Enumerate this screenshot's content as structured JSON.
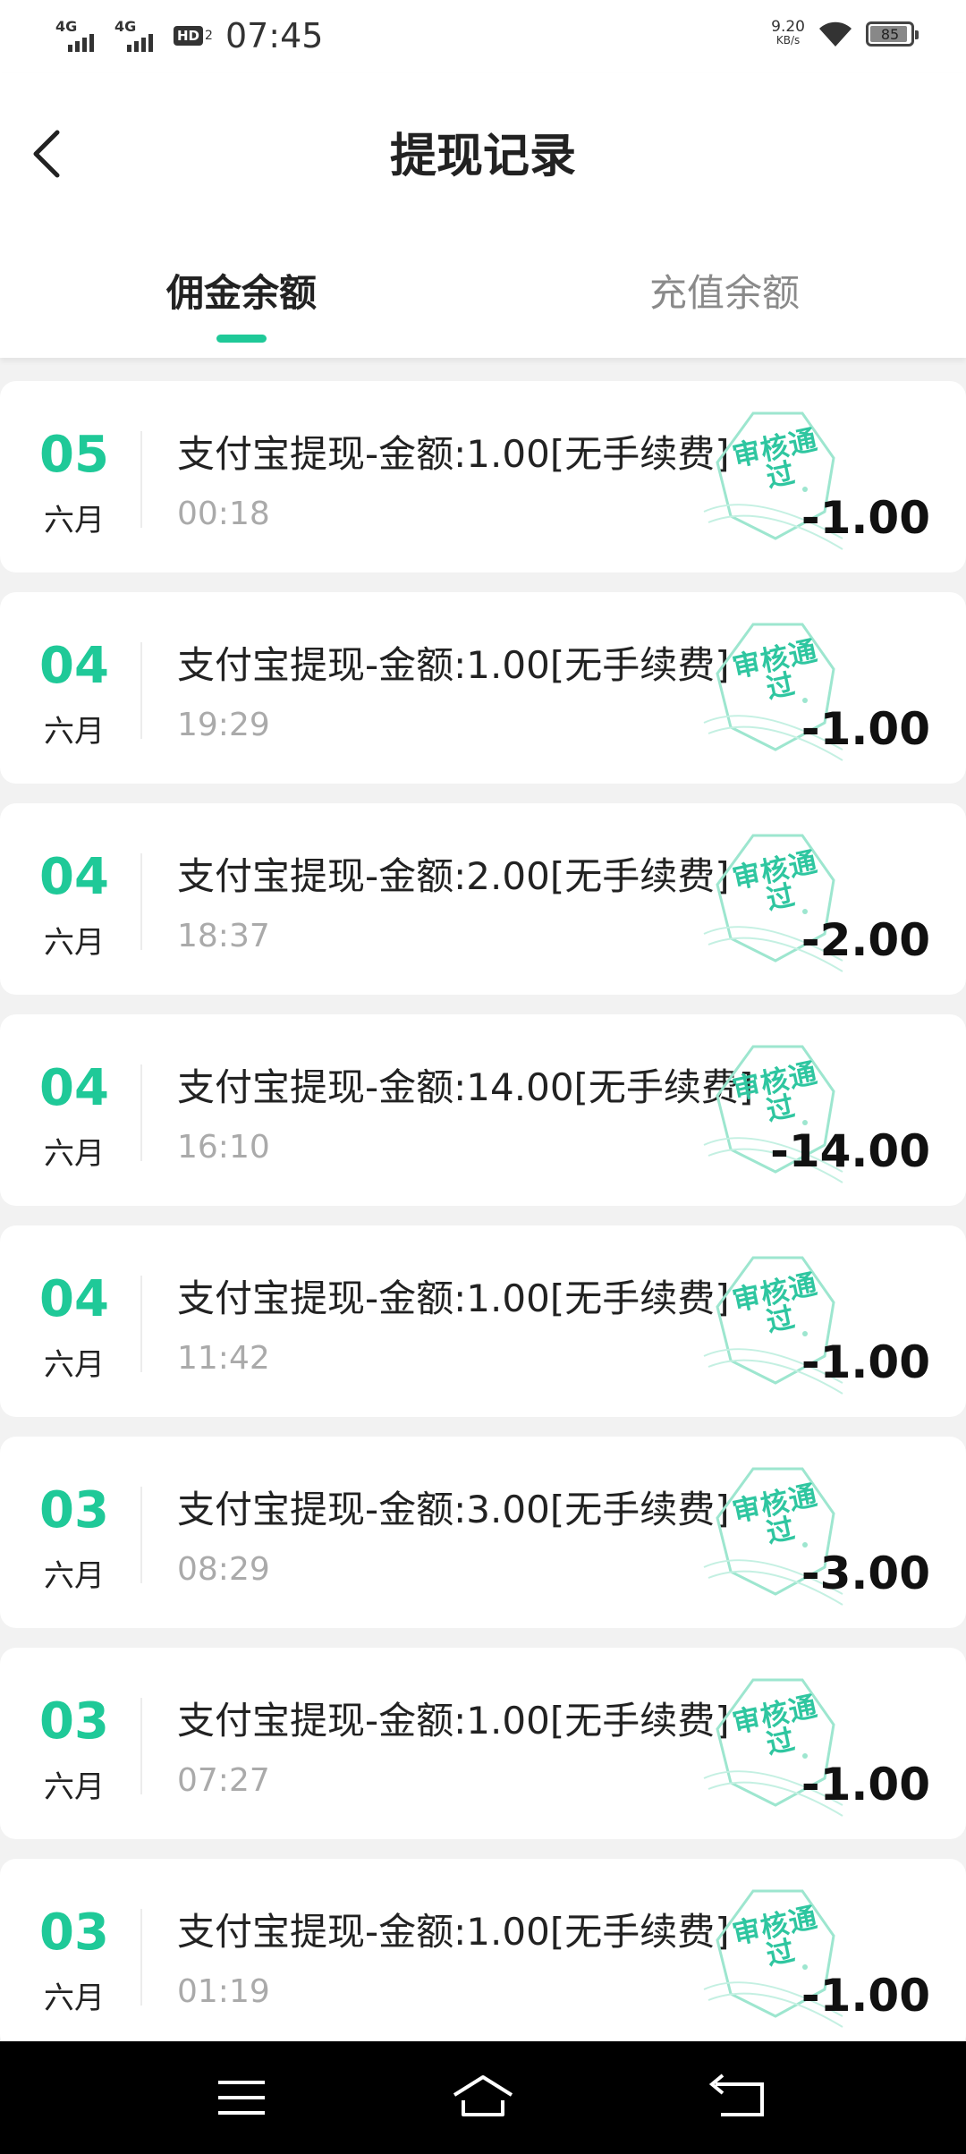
{
  "status_bar": {
    "signal1": "4G",
    "signal2": "4G",
    "hd": "HD",
    "hd_sub": "2",
    "time": "07:45",
    "speed_value": "9.20",
    "speed_unit": "KB/s",
    "battery": "85"
  },
  "header": {
    "title": "提现记录",
    "tabs": [
      {
        "label": "佣金余额",
        "active": true
      },
      {
        "label": "充值余额",
        "active": false
      }
    ]
  },
  "colors": {
    "accent": "#1fc998",
    "stamp": "#2fc6a0"
  },
  "records": [
    {
      "day": "05",
      "month": "六月",
      "description": "支付宝提现-金额:1.00[无手续费]",
      "time": "00:18",
      "status": "审核通过",
      "amount": "-1.00"
    },
    {
      "day": "04",
      "month": "六月",
      "description": "支付宝提现-金额:1.00[无手续费]",
      "time": "19:29",
      "status": "审核通过",
      "amount": "-1.00"
    },
    {
      "day": "04",
      "month": "六月",
      "description": "支付宝提现-金额:2.00[无手续费]",
      "time": "18:37",
      "status": "审核通过",
      "amount": "-2.00"
    },
    {
      "day": "04",
      "month": "六月",
      "description": "支付宝提现-金额:14.00[无手续费]",
      "time": "16:10",
      "status": "审核通过",
      "amount": "-14.00"
    },
    {
      "day": "04",
      "month": "六月",
      "description": "支付宝提现-金额:1.00[无手续费]",
      "time": "11:42",
      "status": "审核通过",
      "amount": "-1.00"
    },
    {
      "day": "03",
      "month": "六月",
      "description": "支付宝提现-金额:3.00[无手续费]",
      "time": "08:29",
      "status": "审核通过",
      "amount": "-3.00"
    },
    {
      "day": "03",
      "month": "六月",
      "description": "支付宝提现-金额:1.00[无手续费]",
      "time": "07:27",
      "status": "审核通过",
      "amount": "-1.00"
    },
    {
      "day": "03",
      "month": "六月",
      "description": "支付宝提现-金额:1.00[无手续费]",
      "time": "01:19",
      "status": "审核通过",
      "amount": "-1.00"
    }
  ],
  "nav_icons": [
    "menu-icon",
    "home-icon",
    "back-icon"
  ]
}
